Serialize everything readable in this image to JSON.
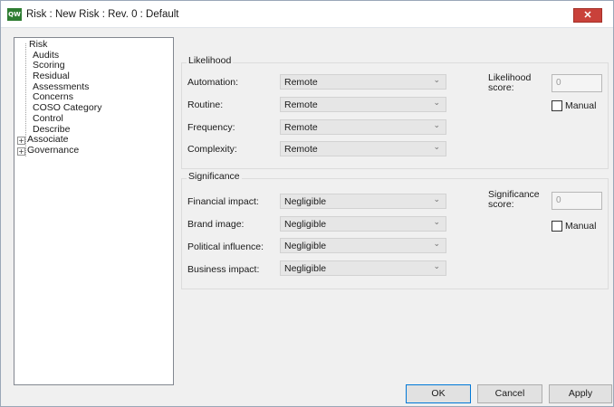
{
  "window": {
    "title": "Risk : New Risk : Rev. 0  : Default",
    "app_icon_text": "QW",
    "close_glyph": "✕"
  },
  "tree": {
    "root": "Risk",
    "children": [
      "Audits",
      "Scoring",
      "Residual",
      "Assessments",
      "Concerns",
      "COSO Category",
      "Control",
      "Describe"
    ],
    "expandables": [
      "Associate",
      "Governance"
    ],
    "expander_glyph": "+"
  },
  "likelihood": {
    "title": "Likelihood",
    "fields": [
      {
        "label": "Automation:",
        "value": "Remote"
      },
      {
        "label": "Routine:",
        "value": "Remote"
      },
      {
        "label": "Frequency:",
        "value": "Remote"
      },
      {
        "label": "Complexity:",
        "value": "Remote"
      }
    ],
    "score_label_1": "Likelihood",
    "score_label_2": "score:",
    "score_value": "0",
    "manual_label": "Manual"
  },
  "significance": {
    "title": "Significance",
    "fields": [
      {
        "label": "Financial impact:",
        "value": "Negligible"
      },
      {
        "label": "Brand image:",
        "value": "Negligible"
      },
      {
        "label": "Political influence:",
        "value": "Negligible"
      },
      {
        "label": "Business impact:",
        "value": "Negligible"
      }
    ],
    "score_label_1": "Significance",
    "score_label_2": "score:",
    "score_value": "0",
    "manual_label": "Manual"
  },
  "combo_arrow": "⌄",
  "buttons": {
    "ok": "OK",
    "cancel": "Cancel",
    "apply": "Apply"
  },
  "colors": {
    "close_button": "#c9413a",
    "app_icon": "#2e7d32",
    "default_button_border": "#0078d7"
  }
}
